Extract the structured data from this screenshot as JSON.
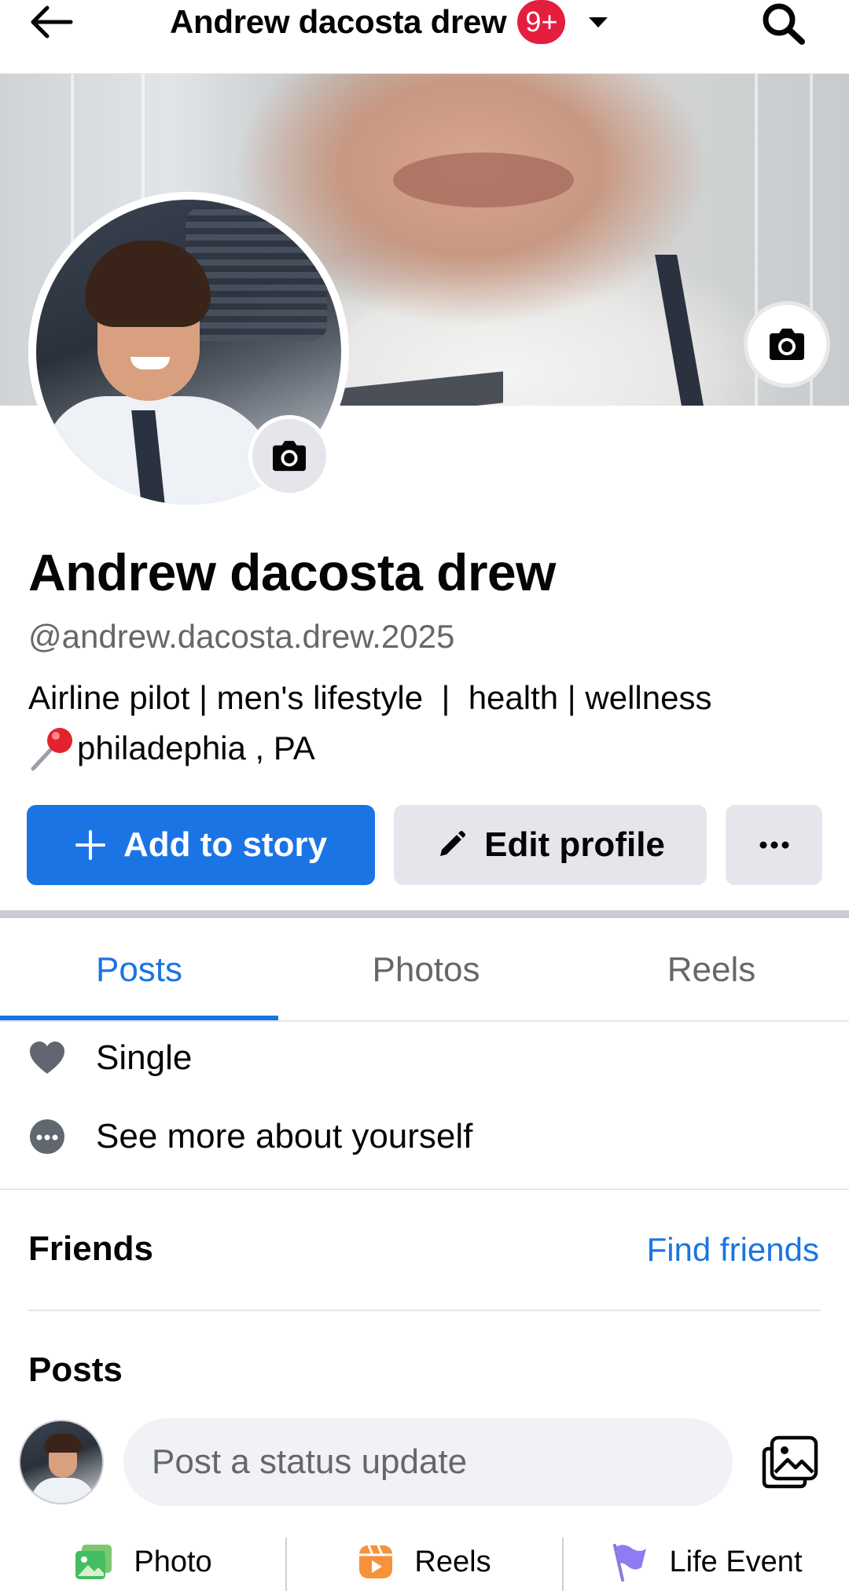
{
  "topbar": {
    "title": "Andrew dacosta drew",
    "notification_badge": "9+"
  },
  "profile": {
    "name": "Andrew dacosta drew",
    "handle": "@andrew.dacosta.drew.2025",
    "bio_line1": "Airline pilot | men's lifestyle  |  health | wellness",
    "bio_line2_location": "philadephia , PA"
  },
  "actions": {
    "add_to_story": "Add to story",
    "edit_profile": "Edit profile",
    "more": "···"
  },
  "tabs": [
    "Posts",
    "Photos",
    "Reels"
  ],
  "active_tab": "Posts",
  "details": {
    "relationship": "Single",
    "see_more": "See more about yourself"
  },
  "friends": {
    "title": "Friends",
    "find_friends": "Find friends"
  },
  "posts": {
    "title": "Posts",
    "composer_placeholder": "Post a status update",
    "actions": [
      {
        "label": "Photo",
        "icon": "photo-icon"
      },
      {
        "label": "Reels",
        "icon": "reels-icon"
      },
      {
        "label": "Life Event",
        "icon": "flag-icon"
      }
    ]
  },
  "colors": {
    "accent": "#1b74e4",
    "badge": "#e41e3f",
    "secondary_button": "#e4e6eb",
    "muted_text": "#65676b"
  }
}
